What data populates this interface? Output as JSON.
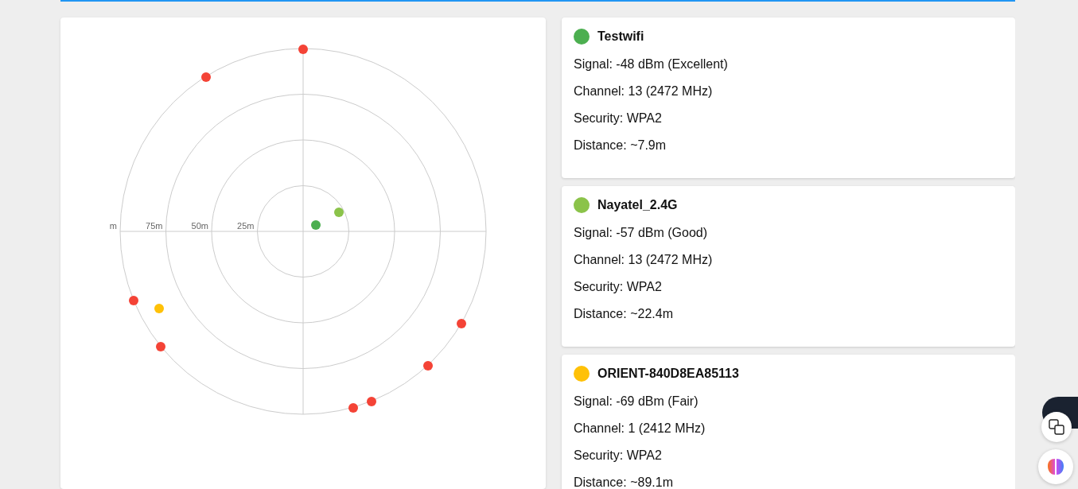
{
  "radar": {
    "ring_labels": [
      "m",
      "75m",
      "50m",
      "25m"
    ],
    "dots": [
      {
        "color": "#f44336"
      },
      {
        "color": "#f44336"
      },
      {
        "color": "#f44336"
      },
      {
        "color": "#f44336"
      },
      {
        "color": "#f44336"
      },
      {
        "color": "#f44336"
      },
      {
        "color": "#f44336"
      },
      {
        "color": "#f44336"
      },
      {
        "color": "#ffc107"
      },
      {
        "color": "#4caf50"
      },
      {
        "color": "#8bc34a"
      }
    ]
  },
  "networks": [
    {
      "name": "Testwifi",
      "color": "#4caf50",
      "details": [
        "Signal: -48 dBm (Excellent)",
        "Channel: 13 (2472 MHz)",
        "Security: WPA2",
        "Distance: ~7.9m"
      ]
    },
    {
      "name": "Nayatel_2.4G",
      "color": "#8bc34a",
      "details": [
        "Signal: -57 dBm (Good)",
        "Channel: 13 (2472 MHz)",
        "Security: WPA2",
        "Distance: ~22.4m"
      ]
    },
    {
      "name": "ORIENT-840D8EA85113",
      "color": "#ffc107",
      "details": [
        "Signal: -69 dBm (Fair)",
        "Channel: 1 (2412 MHz)",
        "Security: WPA2",
        "Distance: ~89.1m"
      ]
    }
  ]
}
